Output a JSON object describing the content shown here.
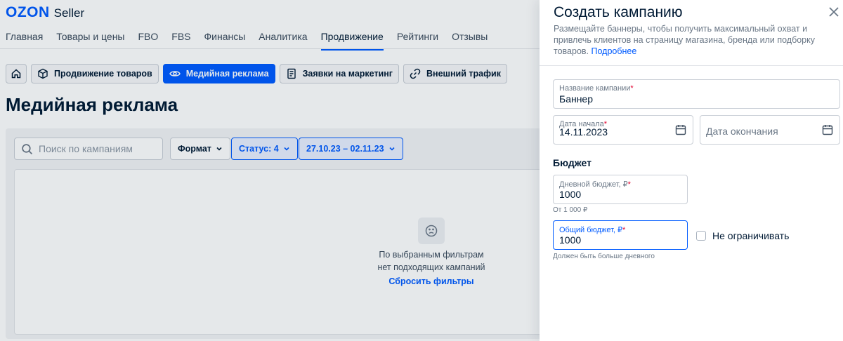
{
  "header": {
    "logo_brand": "OZON",
    "logo_product": "Seller",
    "nav": [
      "Главная",
      "Товары и цены",
      "FBO",
      "FBS",
      "Финансы",
      "Аналитика",
      "Продвижение",
      "Рейтинги",
      "Отзывы"
    ],
    "nav_active_index": 6
  },
  "sections": {
    "chips": [
      "Продвижение товаров",
      "Медийная реклама",
      "Заявки на маркетинг",
      "Внешний трафик"
    ],
    "active_chip_index": 1
  },
  "page": {
    "title": "Медийная реклама",
    "search_placeholder": "Поиск по кампаниям",
    "filters": {
      "format_label": "Формат",
      "status_label": "Статус: 4",
      "date_range": "27.10.23 – 02.11.23"
    },
    "empty_state": {
      "line1": "По выбранным фильтрам",
      "line2": "нет подходящих кампаний",
      "reset_link": "Сбросить фильтры"
    }
  },
  "drawer": {
    "title": "Создать кампанию",
    "description": "Размещайте баннеры, чтобы получить максимальный охват и привлечь клиентов на страницу магазина, бренда или подборку товаров.",
    "more_link": "Подробнее",
    "campaign_name": {
      "label": "Название кампании",
      "value": "Баннер"
    },
    "start_date": {
      "label": "Дата начала",
      "value": "14.11.2023"
    },
    "end_date": {
      "placeholder": "Дата окончания"
    },
    "budget_title": "Бюджет",
    "daily_budget": {
      "label": "Дневной бюджет, ₽",
      "value": "1000",
      "hint": "От 1 000 ₽"
    },
    "total_budget": {
      "label": "Общий бюджет, ₽",
      "value": "1000",
      "hint": "Должен быть больше дневного"
    },
    "unlimited_label": "Не ограничивать",
    "required_mark": "*"
  },
  "colors": {
    "accent": "#005bff",
    "required": "#e1002e",
    "text": "#001a34"
  }
}
